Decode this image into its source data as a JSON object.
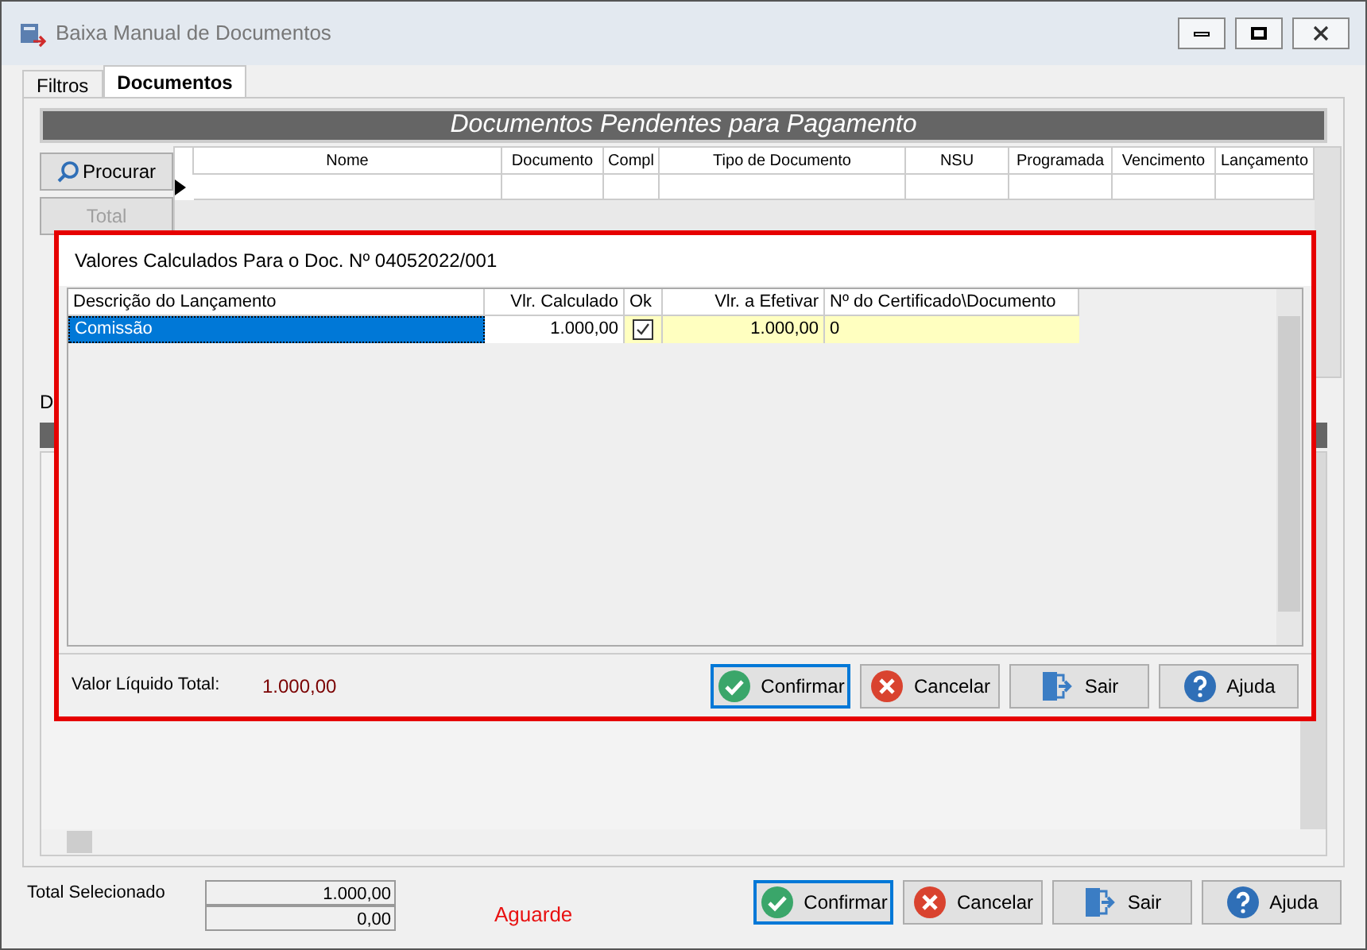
{
  "window": {
    "title": "Baixa Manual de Documentos"
  },
  "tabs": [
    {
      "label": "Filtros",
      "selected": false
    },
    {
      "label": "Documentos",
      "selected": true
    }
  ],
  "panel_title": "Documentos Pendentes para Pagamento",
  "side_buttons": [
    {
      "label": "Procurar",
      "disabled": false,
      "kind": "search"
    },
    {
      "label": "Total",
      "disabled": true,
      "kind": "total"
    }
  ],
  "grid": {
    "columns": [
      "Nome",
      "Documento",
      "Compl",
      "Tipo de Documento",
      "NSU",
      "Programada",
      "Vencimento",
      "Lançamento"
    ]
  },
  "section_label": "D",
  "dialog": {
    "title": "Valores Calculados Para o Doc. Nº 04052022/001",
    "columns": [
      "Descrição do Lançamento",
      "Vlr. Calculado",
      "Ok",
      "Vlr. a Efetivar",
      "Nº do Certificado\\Documento"
    ],
    "rows": [
      {
        "description": "Comissão",
        "calculated": "1.000,00",
        "ok": true,
        "to_settle": "1.000,00",
        "certificate": "0",
        "selected": true
      }
    ],
    "total_label": "Valor Líquido Total:",
    "total_value": "1.000,00",
    "buttons": [
      {
        "label": "Confirmar",
        "kind": "confirm",
        "default": true
      },
      {
        "label": "Cancelar",
        "kind": "cancel",
        "default": false
      },
      {
        "label": "Sair",
        "kind": "exit",
        "default": false
      },
      {
        "label": "Ajuda",
        "kind": "help",
        "default": false
      }
    ]
  },
  "footer": {
    "total_label": "Total Selecionado",
    "values": [
      "1.000,00",
      "0,00"
    ],
    "status": "Aguarde",
    "buttons": [
      {
        "label": "Confirmar",
        "kind": "confirm",
        "default": true
      },
      {
        "label": "Cancelar",
        "kind": "cancel",
        "default": false
      },
      {
        "label": "Sair",
        "kind": "exit",
        "default": false
      },
      {
        "label": "Ajuda",
        "kind": "help",
        "default": false
      }
    ]
  }
}
